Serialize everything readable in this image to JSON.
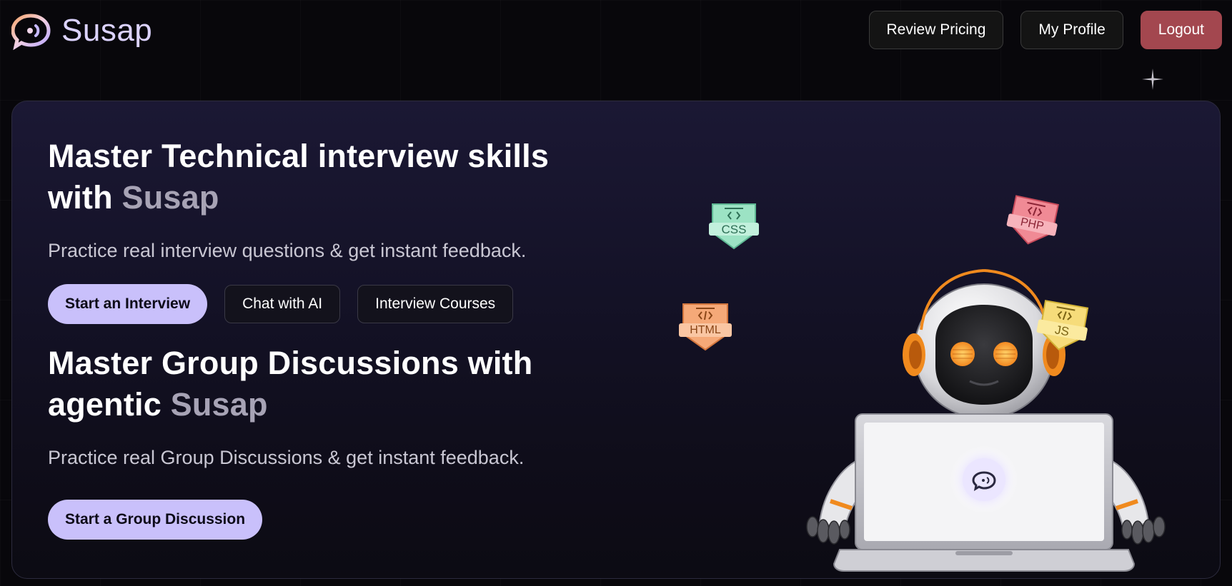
{
  "brand": {
    "name": "Susap",
    "logo_icon": "chat-bubble-icon"
  },
  "nav": {
    "review_pricing": "Review Pricing",
    "my_profile": "My Profile",
    "logout": "Logout"
  },
  "hero": {
    "interview": {
      "heading_prefix": "Master Technical interview skills with",
      "heading_accent": "Susap",
      "subtext": "Practice real interview questions & get instant feedback.",
      "buttons": {
        "start": "Start an Interview",
        "chat": "Chat with AI",
        "courses": "Interview Courses"
      }
    },
    "group": {
      "heading_prefix": "Master Group Discussions with agentic",
      "heading_accent": "Susap",
      "subtext": "Practice real Group Discussions & get instant feedback.",
      "buttons": {
        "start": "Start a Group Discussion"
      }
    }
  },
  "illustration": {
    "badges": {
      "css": "CSS",
      "php": "PHP",
      "html": "HTML",
      "js": "JS"
    },
    "description_icon": "robot-with-laptop-icon"
  },
  "colors": {
    "accent": "#c9c0fb",
    "logout": "#a3474f",
    "brand_text": "#dcd3ff",
    "heading_accent": "#a7a3b5"
  }
}
